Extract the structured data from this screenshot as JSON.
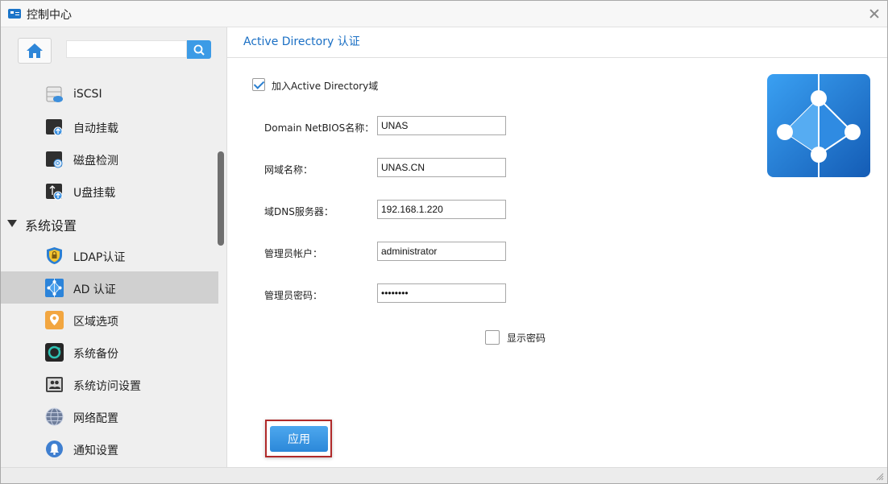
{
  "window": {
    "title": "控制中心"
  },
  "sidebar": {
    "search": {
      "value": "",
      "placeholder": ""
    },
    "items": [
      {
        "label": "iSCSI",
        "icon": "iscsi-icon"
      },
      {
        "label": "自动挂载",
        "icon": "auto-mount-icon"
      },
      {
        "label": "磁盘检测",
        "icon": "disk-check-icon"
      },
      {
        "label": "U盘挂载",
        "icon": "usb-mount-icon"
      }
    ],
    "section": {
      "label": "系统设置",
      "expanded": true
    },
    "section_items": [
      {
        "label": "LDAP认证",
        "icon": "ldap-shield-icon"
      },
      {
        "label": "AD 认证",
        "icon": "ad-icon",
        "active": true
      },
      {
        "label": "区域选项",
        "icon": "region-icon"
      },
      {
        "label": "系统备份",
        "icon": "backup-icon"
      },
      {
        "label": "系统访问设置",
        "icon": "access-icon"
      },
      {
        "label": "网络配置",
        "icon": "network-icon"
      },
      {
        "label": "通知设置",
        "icon": "notification-icon"
      }
    ]
  },
  "content": {
    "title": "Active Directory 认证",
    "join_domain": {
      "label": "加入Active Directory域",
      "checked": true
    },
    "fields": {
      "netbios": {
        "label": "Domain NetBIOS名称：",
        "value": "UNAS"
      },
      "domain_name": {
        "label": "网域名称：",
        "value": "UNAS.CN"
      },
      "dns_server": {
        "label": "域DNS服务器：",
        "value": "192.168.1.220"
      },
      "admin_account": {
        "label": "管理员帐户：",
        "value": "administrator"
      },
      "admin_password": {
        "label": "管理员密码：",
        "value": "password"
      }
    },
    "show_password": {
      "label": "显示密码",
      "checked": false
    },
    "apply_button": "应用",
    "accent_color": "#1a6fc4",
    "button_color": "#2b88d9",
    "highlight_color": "#b02a2a"
  }
}
